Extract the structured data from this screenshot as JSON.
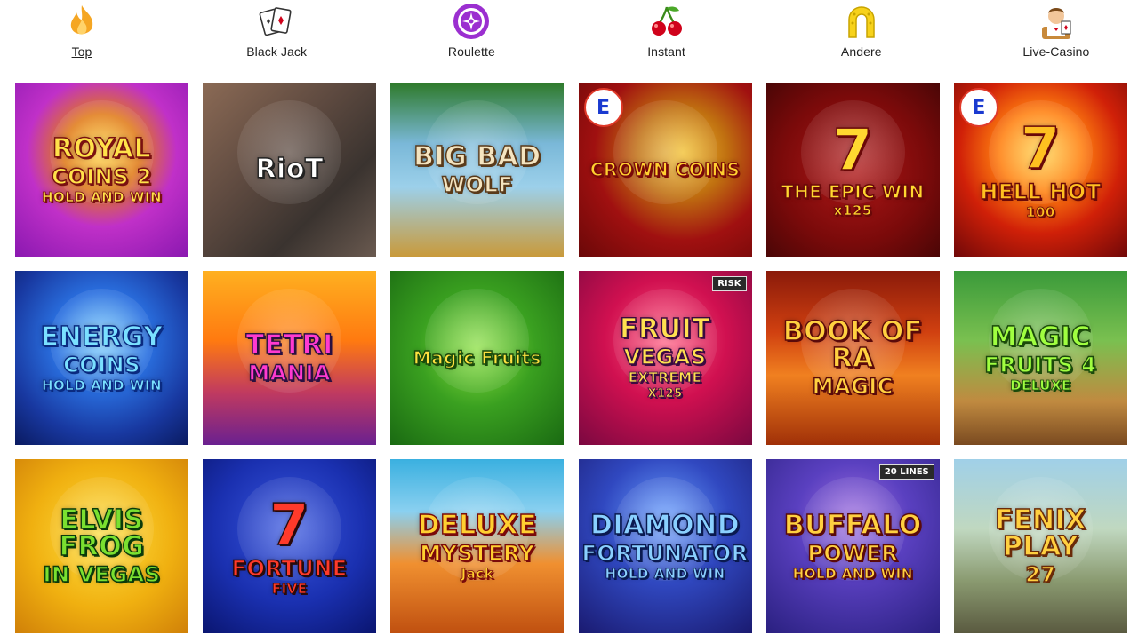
{
  "categories": [
    {
      "label": "Top",
      "icon": "flame-icon",
      "active": true
    },
    {
      "label": "Black Jack",
      "icon": "playing-cards-icon",
      "active": false
    },
    {
      "label": "Roulette",
      "icon": "roulette-icon",
      "active": false
    },
    {
      "label": "Instant",
      "icon": "cherries-icon",
      "active": false
    },
    {
      "label": "Andere",
      "icon": "horseshoe-icon",
      "active": false
    },
    {
      "label": "Live-Casino",
      "icon": "dealer-icon",
      "active": false
    }
  ],
  "games": [
    {
      "lines": [
        "ROYAL",
        "COINS 2",
        "HOLD AND WIN"
      ],
      "bg": "radial-gradient(circle at 50% 40%, #ffd23a 0%, #e07a18 28%, #c030c8 55%, #8a18b0 100%)",
      "color": "#ffe24a",
      "stroke": "#7a1010"
    },
    {
      "lines": [
        "RioT"
      ],
      "bg": "linear-gradient(135deg, #8b6a55 0%, #5e4a40 40%, #3a332f 70%, #6a5a50 100%)",
      "color": "#ffffff",
      "stroke": "#222"
    },
    {
      "lines": [
        "BIG BAD",
        "WOLF"
      ],
      "bg": "linear-gradient(180deg, #2e7a2a 0%, #7ab8d8 35%, #9cd0ea 60%, #c99a3a 100%)",
      "color": "#f4e4c0",
      "stroke": "#5a3a1a"
    },
    {
      "lines": [
        "CROWN COINS"
      ],
      "bg": "radial-gradient(circle at 60% 40%, #f2c030 0%, #c07010 30%, #a01010 60%, #6a0808 100%)",
      "color": "#ffd030",
      "stroke": "#7a0808",
      "badge": "E"
    },
    {
      "lines": [
        "7",
        "THE EPIC WIN",
        "x125"
      ],
      "bg": "radial-gradient(circle at 50% 50%, #b01818 0%, #7a0a0a 60%, #4a0606 100%)",
      "color": "#ffd830",
      "stroke": "#6a0808"
    },
    {
      "lines": [
        "7",
        "HELL HOT",
        "100"
      ],
      "bg": "radial-gradient(circle at 50% 40%, #ffd040 0%, #ff8010 30%, #d02008 60%, #700808 100%)",
      "color": "#ffc020",
      "stroke": "#6a0808",
      "badge": "E"
    },
    {
      "lines": [
        "ENERGY",
        "COINS",
        "HOLD AND WIN"
      ],
      "bg": "radial-gradient(circle at 50% 40%, #7ad0ff 0%, #2a70e0 35%, #1838a0 70%, #0a1a60 100%)",
      "color": "#7ae0ff",
      "stroke": "#0a2a80"
    },
    {
      "lines": [
        "TETRI",
        "MANIA"
      ],
      "bg": "linear-gradient(180deg, #ffb020 0%, #ff7a10 40%, #c03a60 70%, #6a2090 100%)",
      "color": "#ff3ad0",
      "stroke": "#2a1040"
    },
    {
      "lines": [
        "Magic Fruits"
      ],
      "bg": "radial-gradient(circle at 50% 45%, #8ae040 0%, #3aa020 45%, #1a6a12 100%)",
      "color": "#ffe040",
      "stroke": "#1a4a0a"
    },
    {
      "lines": [
        "FRUIT",
        "VEGAS",
        "EXTREME",
        "X125"
      ],
      "bg": "radial-gradient(circle at 50% 40%, #ff5a80 0%, #d01050 45%, #7a0840 100%)",
      "color": "#ffe050",
      "stroke": "#3a0a40",
      "badge": "RISK"
    },
    {
      "lines": [
        "BOOK OF RA",
        "MAGIC"
      ],
      "bg": "linear-gradient(180deg, #8a1a0a 0%, #d04010 35%, #f08020 60%, #a03008 100%)",
      "color": "#ffd040",
      "stroke": "#5a0a0a"
    },
    {
      "lines": [
        "MAGIC",
        "FRUITS 4",
        "DELUXE"
      ],
      "bg": "linear-gradient(180deg, #3a9a3a 0%, #7ac050 40%, #c08a40 75%, #7a4a20 100%)",
      "color": "#a0ff40",
      "stroke": "#1a4a0a"
    },
    {
      "lines": [
        "ELVIS FROG",
        "IN VEGAS"
      ],
      "bg": "radial-gradient(circle at 50% 45%, #ffe040 0%, #f0b010 55%, #d08008 100%)",
      "color": "#7ae030",
      "stroke": "#0a3a0a"
    },
    {
      "lines": [
        "7",
        "FORTUNE",
        "FIVE"
      ],
      "bg": "radial-gradient(circle at 50% 40%, #3a58e0 0%, #1a30b0 55%, #0a1570 100%)",
      "color": "#ff3a2a",
      "stroke": "#2a0a0a"
    },
    {
      "lines": [
        "DELUXE",
        "MYSTERY",
        "Jack"
      ],
      "bg": "linear-gradient(180deg, #3ab0e0 0%, #8ad0f0 30%, #f09030 60%, #c05010 100%)",
      "color": "#ffd030",
      "stroke": "#7a0a0a"
    },
    {
      "lines": [
        "DIAMOND",
        "FORTUNATOR",
        "HOLD AND WIN"
      ],
      "bg": "radial-gradient(circle at 50% 35%, #6aa0ff 0%, #3048c0 45%, #1a1a70 100%)",
      "color": "#8ad0ff",
      "stroke": "#0a1a50"
    },
    {
      "lines": [
        "BUFFALO",
        "POWER",
        "HOLD AND WIN"
      ],
      "bg": "radial-gradient(circle at 50% 35%, #a070e0 0%, #5a40c0 40%, #2a2080 100%)",
      "color": "#ffd040",
      "stroke": "#5a0a0a",
      "badge": "20 LINES"
    },
    {
      "lines": [
        "FENIX PLAY",
        "27"
      ],
      "bg": "linear-gradient(180deg, #a0d0e8 0%, #c0d8c0 40%, #8a9a70 70%, #5a5a40 100%)",
      "color": "#ffd040",
      "stroke": "#6a2a08"
    }
  ]
}
